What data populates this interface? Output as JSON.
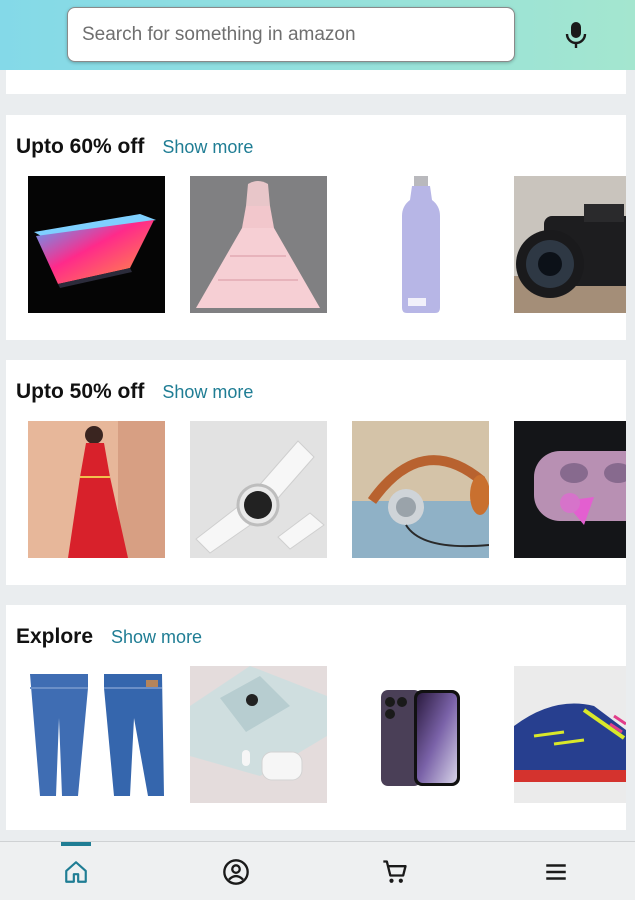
{
  "search": {
    "placeholder": "Search for something in amazon",
    "icon": "mic-icon"
  },
  "sections": [
    {
      "title": "Upto 60% off",
      "show_more_label": "Show more",
      "items": [
        {
          "name": "laptop-image"
        },
        {
          "name": "pink-dress-image"
        },
        {
          "name": "water-bottle-image"
        },
        {
          "name": "camera-image"
        }
      ]
    },
    {
      "title": "Upto 50% off",
      "show_more_label": "Show more",
      "items": [
        {
          "name": "red-dress-image"
        },
        {
          "name": "smartwatch-image"
        },
        {
          "name": "headphones-image"
        },
        {
          "name": "earbuds-image"
        }
      ]
    },
    {
      "title": "Explore",
      "show_more_label": "Show more",
      "items": [
        {
          "name": "jeans-image"
        },
        {
          "name": "phone-airpods-image"
        },
        {
          "name": "iphone-image"
        },
        {
          "name": "sneaker-image"
        }
      ]
    }
  ],
  "bottom_nav": {
    "items": [
      {
        "icon": "home-icon",
        "active": true
      },
      {
        "icon": "account-icon",
        "active": false
      },
      {
        "icon": "cart-icon",
        "active": false
      },
      {
        "icon": "menu-icon",
        "active": false
      }
    ],
    "accent": "#1f7d94"
  },
  "colors": {
    "header_gradient_start": "#84d9e8",
    "header_gradient_end": "#a4e6cf",
    "link": "#1f7d94"
  }
}
